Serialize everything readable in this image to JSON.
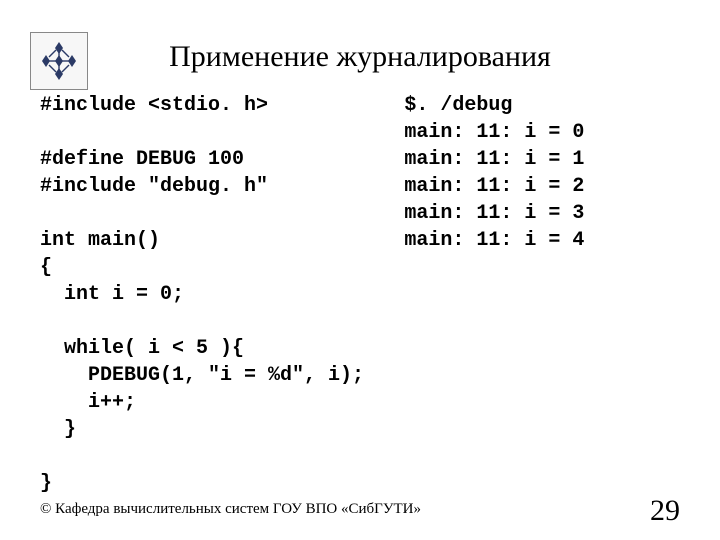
{
  "title": "Применение журналирования",
  "code_left": "#include <stdio. h>\n\n#define DEBUG 100\n#include \"debug. h\"\n\nint main()\n{\n  int i = 0;\n\n  while( i < 5 ){\n    PDEBUG(1, \"i = %d\", i);\n    i++;\n  }\n\n}",
  "output_right": "$. /debug\nmain: 11: i = 0\nmain: 11: i = 1\nmain: 11: i = 2\nmain: 11: i = 3\nmain: 11: i = 4",
  "footer_left": "© Кафедра вычислительных систем ГОУ ВПО «СибГУТИ»",
  "page_number": "29"
}
